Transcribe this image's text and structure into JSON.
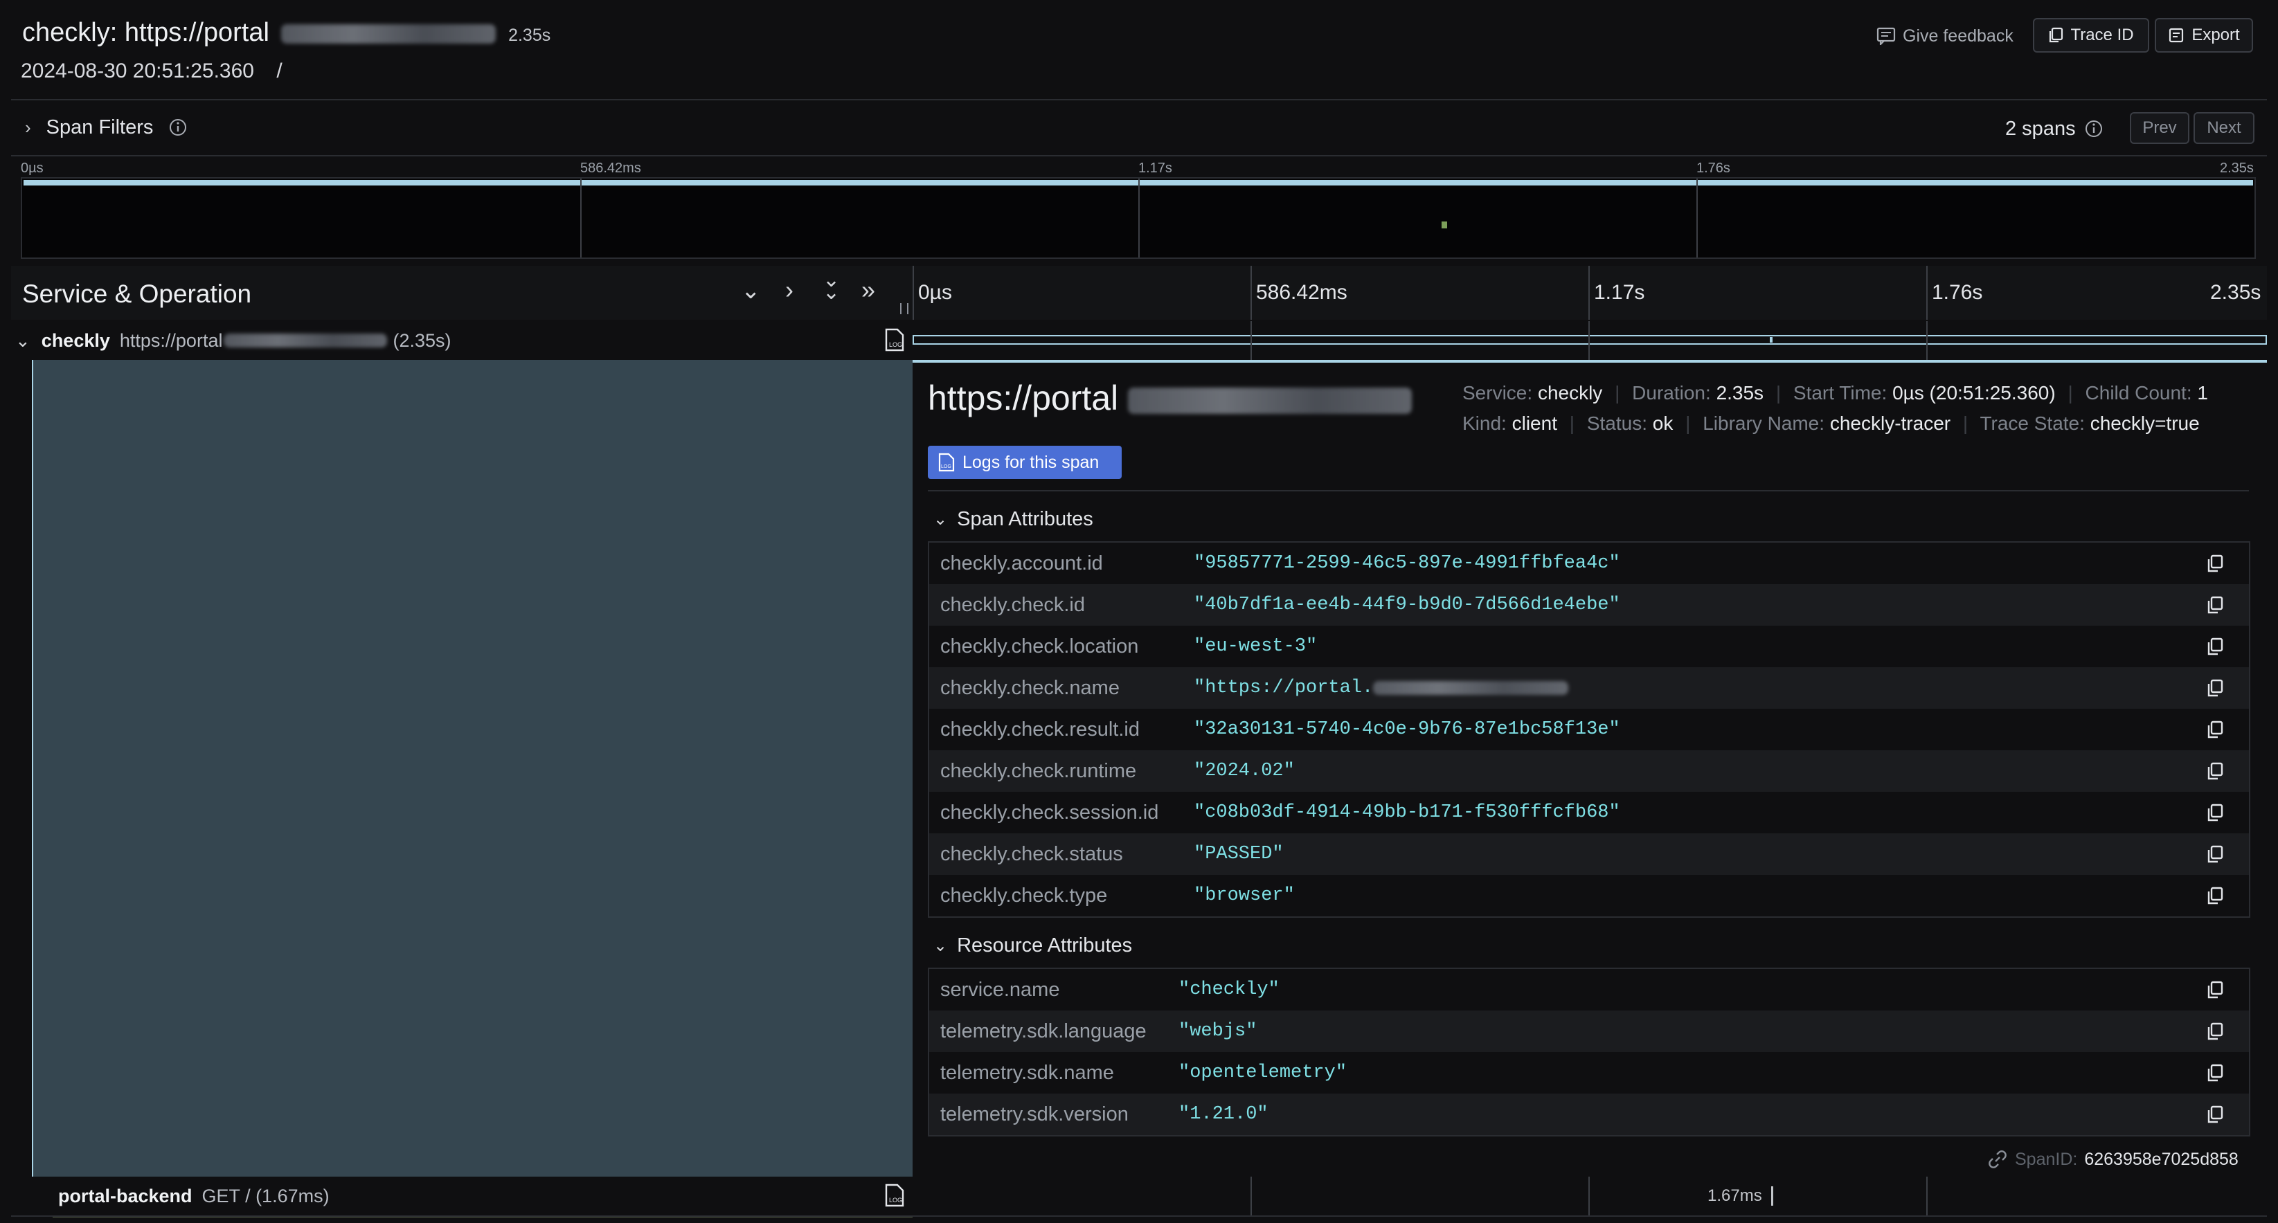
{
  "header": {
    "title_prefix": "checkly: https://portal",
    "duration": "2.35s",
    "timestamp": "2024-08-30 20:51:25.360",
    "separator": "/",
    "give_feedback": "Give feedback",
    "trace_id": "Trace ID",
    "export": "Export"
  },
  "filters": {
    "label": "Span Filters",
    "spans_count": "2 spans",
    "prev": "Prev",
    "next": "Next"
  },
  "minimap": {
    "ticks": [
      "0µs",
      "586.42ms",
      "1.17s",
      "1.76s",
      "2.35s"
    ]
  },
  "timeline_header": {
    "column_title": "Service & Operation",
    "ticks": [
      "0µs",
      "586.42ms",
      "1.17s",
      "1.76s",
      "2.35s"
    ]
  },
  "rows": [
    {
      "service": "checkly",
      "operation": "https://portal",
      "duration": "(2.35s)"
    },
    {
      "service": "portal-backend",
      "operation": "GET / (1.67ms)",
      "duration_label": "1.67ms"
    }
  ],
  "detail": {
    "title": "https://portal",
    "meta_line1": [
      {
        "label": "Service:",
        "value": "checkly"
      },
      {
        "label": "Duration:",
        "value": "2.35s"
      },
      {
        "label": "Start Time:",
        "value": "0µs (20:51:25.360)"
      },
      {
        "label": "Child Count:",
        "value": "1"
      }
    ],
    "meta_line2": [
      {
        "label": "Kind:",
        "value": "client"
      },
      {
        "label": "Status:",
        "value": "ok"
      },
      {
        "label": "Library Name:",
        "value": "checkly-tracer"
      },
      {
        "label": "Trace State:",
        "value": "checkly=true"
      }
    ],
    "logs_button": "Logs for this span",
    "span_attributes_title": "Span Attributes",
    "span_attributes": [
      {
        "key": "checkly.account.id",
        "value": "\"95857771-2599-46c5-897e-4991ffbfea4c\""
      },
      {
        "key": "checkly.check.id",
        "value": "\"40b7df1a-ee4b-44f9-b9d0-7d566d1e4ebe\""
      },
      {
        "key": "checkly.check.location",
        "value": "\"eu-west-3\""
      },
      {
        "key": "checkly.check.name",
        "value": "\"https://portal."
      },
      {
        "key": "checkly.check.result.id",
        "value": "\"32a30131-5740-4c0e-9b76-87e1bc58f13e\""
      },
      {
        "key": "checkly.check.runtime",
        "value": "\"2024.02\""
      },
      {
        "key": "checkly.check.session.id",
        "value": "\"c08b03df-4914-49bb-b171-f530fffcfb68\""
      },
      {
        "key": "checkly.check.status",
        "value": "\"PASSED\""
      },
      {
        "key": "checkly.check.type",
        "value": "\"browser\""
      }
    ],
    "resource_attributes_title": "Resource Attributes",
    "resource_attributes": [
      {
        "key": "service.name",
        "value": "\"checkly\""
      },
      {
        "key": "telemetry.sdk.language",
        "value": "\"webjs\""
      },
      {
        "key": "telemetry.sdk.name",
        "value": "\"opentelemetry\""
      },
      {
        "key": "telemetry.sdk.version",
        "value": "\"1.21.0\""
      }
    ],
    "span_id_label": "SpanID:",
    "span_id": "6263958e7025d858"
  },
  "colors": {
    "accent": "#4b6fd6",
    "span_bar": "#a9d4e6",
    "detail_panel": "#354650",
    "attr_value": "#7fe0e5"
  }
}
